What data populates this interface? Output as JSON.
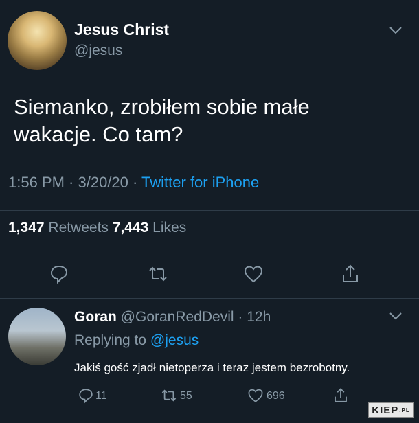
{
  "tweet": {
    "author_name": "Jesus Christ",
    "author_handle": "@jesus",
    "text_line1": "Siemanko, zrobiłem sobie małe",
    "text_line2": "wakacje. Co tam?",
    "time": "1:56 PM · 3/20/20 · ",
    "source": "Twitter for iPhone",
    "retweets_count": "1,347",
    "retweets_label": " Retweets ",
    "likes_count": "7,443",
    "likes_label": " Likes"
  },
  "actions": {
    "icons": [
      "reply-icon",
      "retweet-icon",
      "like-icon",
      "share-icon"
    ]
  },
  "reply": {
    "author_name": "Goran",
    "author_handle_time": " @GoranRedDevil · 12h",
    "replying_prefix": "Replying to ",
    "replying_handle": "@jesus",
    "text": "Jakiś gość zjadł nietoperza i teraz jestem bezrobotny.",
    "reply_count": "11",
    "retweet_count": "55",
    "like_count": "696"
  },
  "watermark": {
    "text": "KIEP",
    "suffix": ".PL"
  },
  "colors": {
    "background": "#141d26",
    "secondary_text": "#8899a6",
    "link": "#1da1f2",
    "divider": "#2f3c48"
  }
}
